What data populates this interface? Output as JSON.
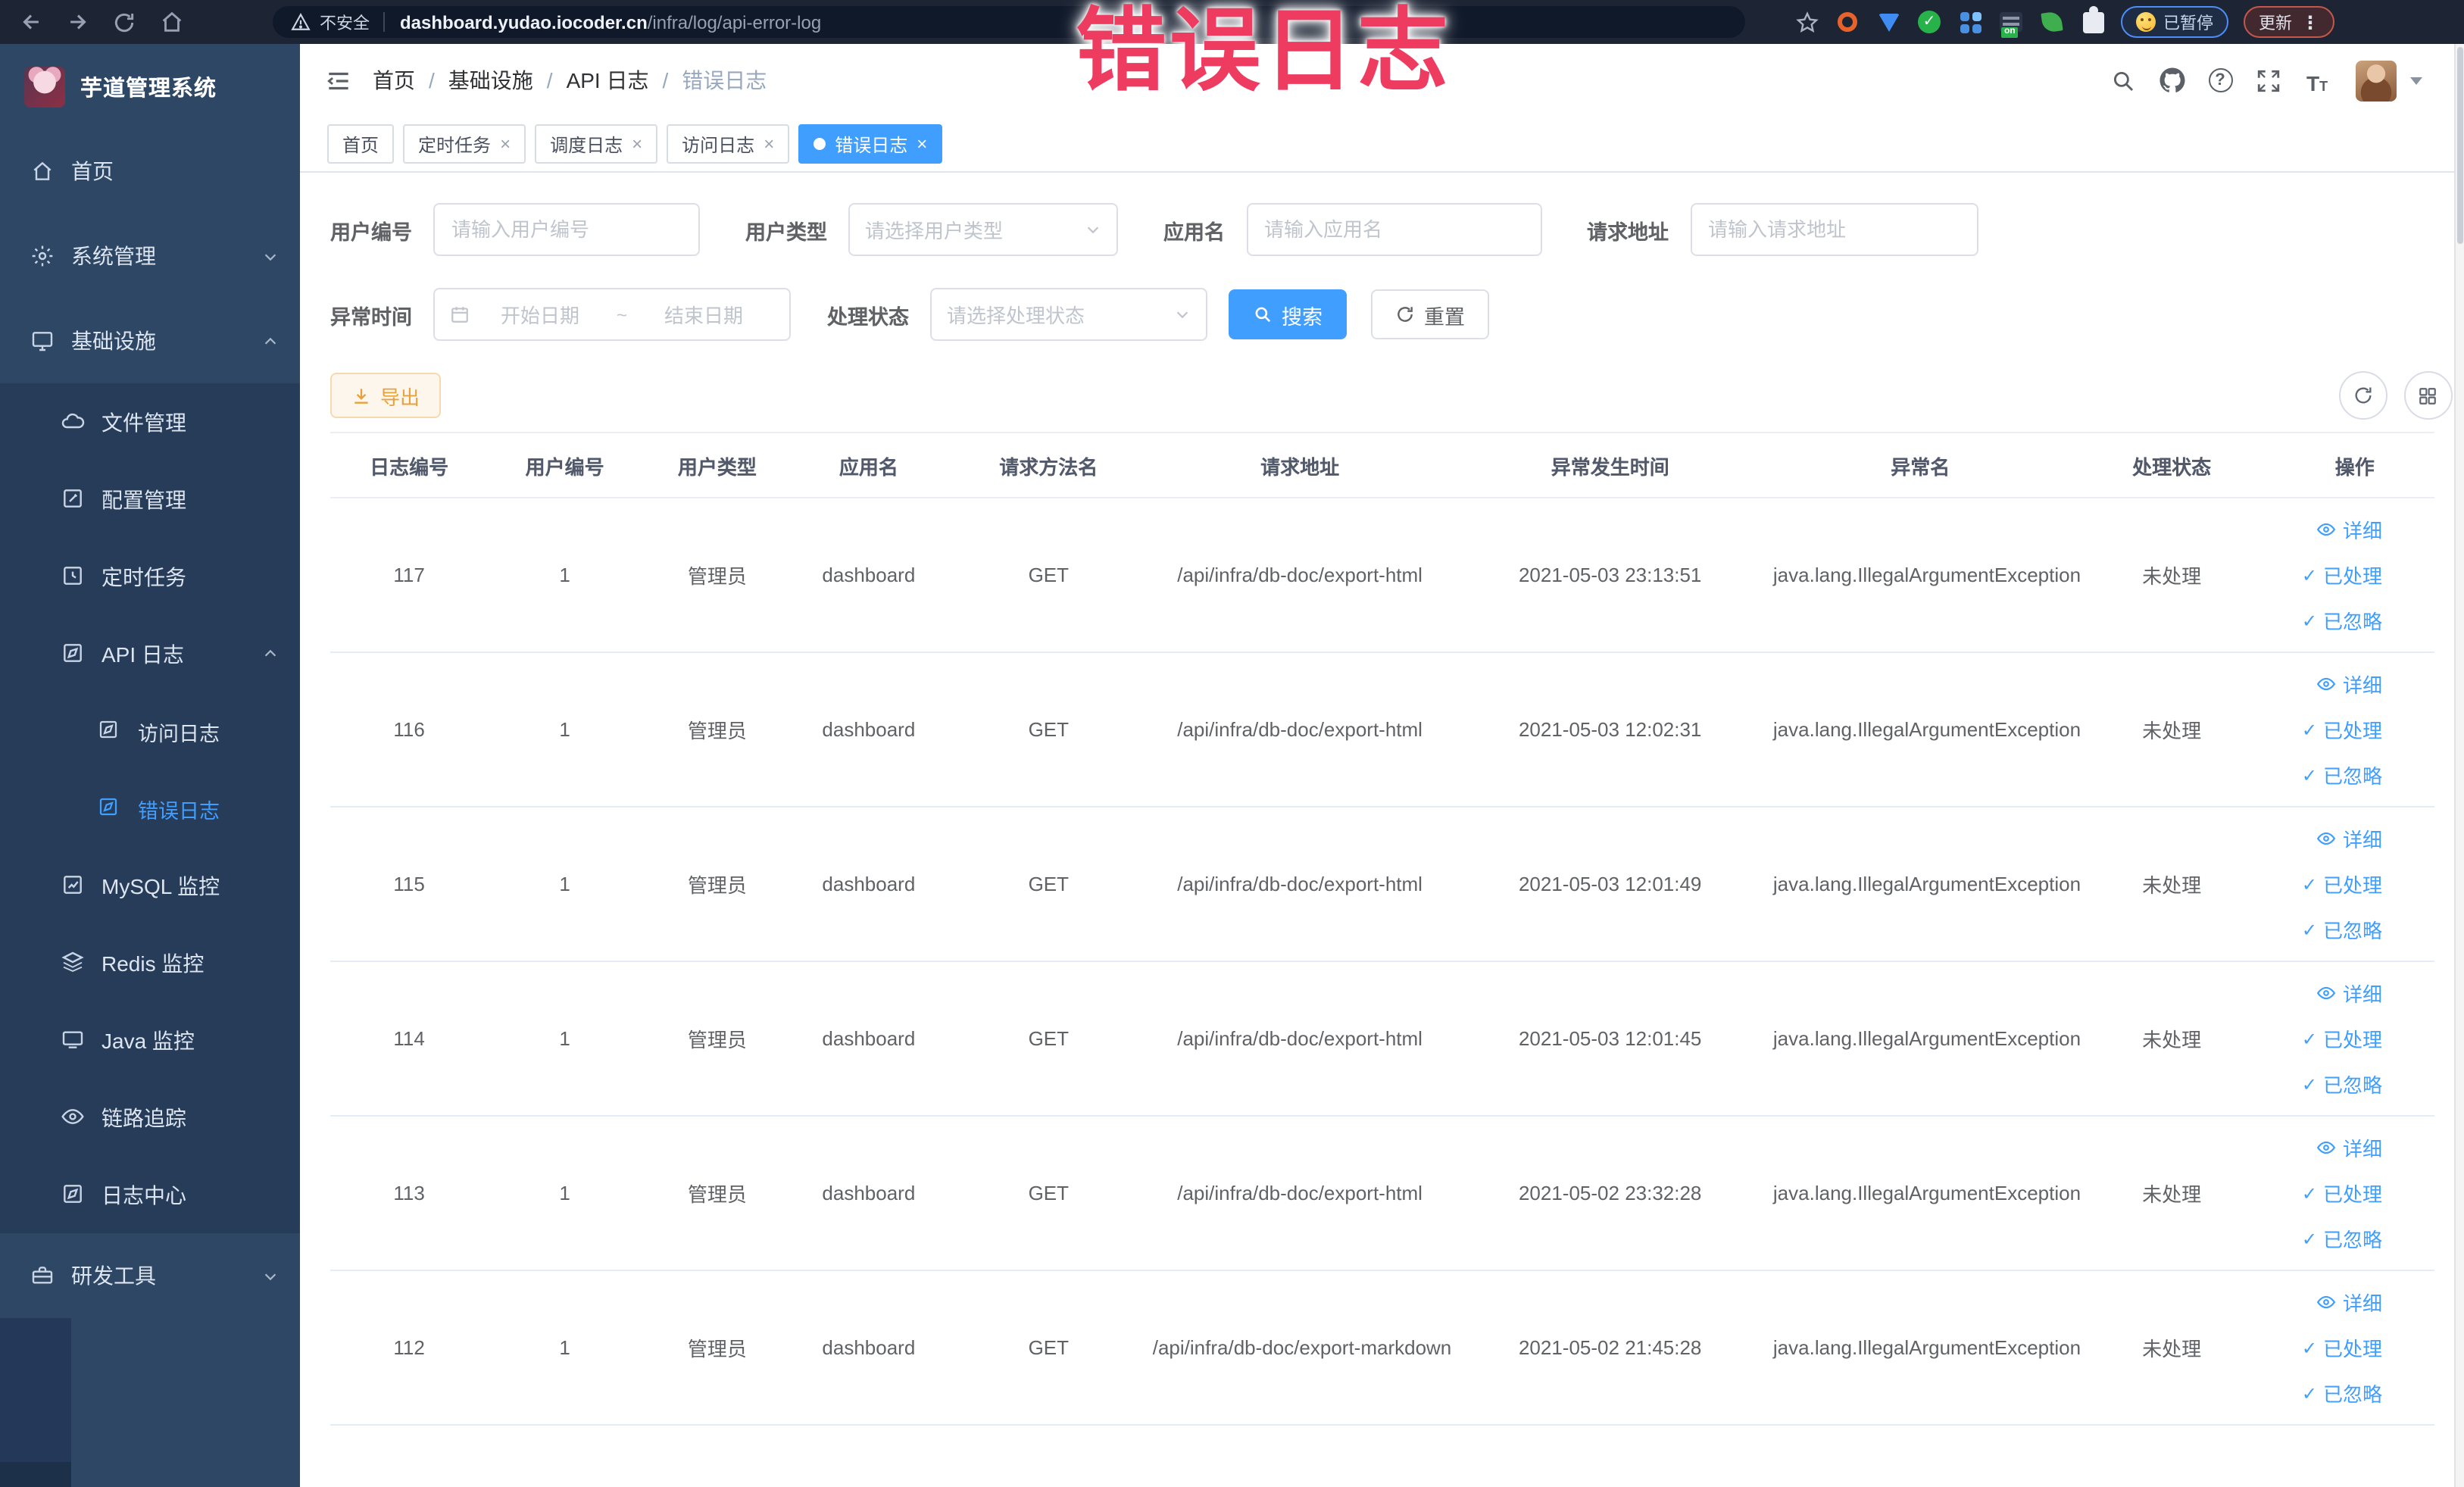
{
  "colors": {
    "accent": "#409eff",
    "watermark": "#ee3b60",
    "chrome_bg": "#1d2433",
    "sidebar_bg": "#2d4765",
    "sidebar_submenu_bg": "#273c59",
    "tag_active_bg": "#409eff",
    "warning_button_bg": "#fdf6ec",
    "warning_button_text": "#e6a23c"
  },
  "watermark": {
    "text": "错误日志"
  },
  "browser": {
    "security_label": "不安全",
    "url_host": "dashboard.yudao.iocoder.cn",
    "url_path": "/infra/log/api-error-log",
    "paused_badge": "已暂停",
    "update_badge": "更新",
    "on_badge": "on"
  },
  "sidebar": {
    "title": "芋道管理系统",
    "items": [
      {
        "label": "首页"
      },
      {
        "label": "系统管理"
      },
      {
        "label": "基础设施"
      },
      {
        "label": "文件管理"
      },
      {
        "label": "配置管理"
      },
      {
        "label": "定时任务"
      },
      {
        "label": "API 日志"
      },
      {
        "label": "访问日志"
      },
      {
        "label": "错误日志"
      },
      {
        "label": "MySQL 监控"
      },
      {
        "label": "Redis 监控"
      },
      {
        "label": "Java 监控"
      },
      {
        "label": "链路追踪"
      },
      {
        "label": "日志中心"
      },
      {
        "label": "研发工具"
      }
    ]
  },
  "breadcrumb": {
    "items": [
      "首页",
      "基础设施",
      "API 日志",
      "错误日志"
    ]
  },
  "tabs": [
    {
      "label": "首页"
    },
    {
      "label": "定时任务"
    },
    {
      "label": "调度日志"
    },
    {
      "label": "访问日志"
    },
    {
      "label": "错误日志"
    }
  ],
  "filters": {
    "user_id": {
      "label": "用户编号",
      "placeholder": "请输入用户编号"
    },
    "user_type": {
      "label": "用户类型",
      "placeholder": "请选择用户类型"
    },
    "app_name": {
      "label": "应用名",
      "placeholder": "请输入应用名"
    },
    "request_url": {
      "label": "请求地址",
      "placeholder": "请输入请求地址"
    },
    "exception_time": {
      "label": "异常时间",
      "start_placeholder": "开始日期",
      "separator": "~",
      "end_placeholder": "结束日期"
    },
    "process_status": {
      "label": "处理状态",
      "placeholder": "请选择处理状态"
    },
    "search_label": "搜索",
    "reset_label": "重置"
  },
  "toolbar": {
    "export_label": "导出"
  },
  "table": {
    "columns": [
      "日志编号",
      "用户编号",
      "用户类型",
      "应用名",
      "请求方法名",
      "请求地址",
      "异常发生时间",
      "异常名",
      "处理状态",
      "操作"
    ],
    "actions": {
      "detail": "详细",
      "processed": "已处理",
      "ignored": "已忽略"
    },
    "rows": [
      {
        "id": "117",
        "user_id": "1",
        "user_type": "管理员",
        "app": "dashboard",
        "method": "GET",
        "url": "/api/infra/db-doc/export-html",
        "time": "2021-05-03 23:13:51",
        "exception": "java.lang.IllegalArgumentException",
        "status": "未处理"
      },
      {
        "id": "116",
        "user_id": "1",
        "user_type": "管理员",
        "app": "dashboard",
        "method": "GET",
        "url": "/api/infra/db-doc/export-html",
        "time": "2021-05-03 12:02:31",
        "exception": "java.lang.IllegalArgumentException",
        "status": "未处理"
      },
      {
        "id": "115",
        "user_id": "1",
        "user_type": "管理员",
        "app": "dashboard",
        "method": "GET",
        "url": "/api/infra/db-doc/export-html",
        "time": "2021-05-03 12:01:49",
        "exception": "java.lang.IllegalArgumentException",
        "status": "未处理"
      },
      {
        "id": "114",
        "user_id": "1",
        "user_type": "管理员",
        "app": "dashboard",
        "method": "GET",
        "url": "/api/infra/db-doc/export-html",
        "time": "2021-05-03 12:01:45",
        "exception": "java.lang.IllegalArgumentException",
        "status": "未处理"
      },
      {
        "id": "113",
        "user_id": "1",
        "user_type": "管理员",
        "app": "dashboard",
        "method": "GET",
        "url": "/api/infra/db-doc/export-html",
        "time": "2021-05-02 23:32:28",
        "exception": "java.lang.IllegalArgumentException",
        "status": "未处理"
      },
      {
        "id": "112",
        "user_id": "1",
        "user_type": "管理员",
        "app": "dashboard",
        "method": "GET",
        "url": "/api/infra/db-doc/export-markdown",
        "time": "2021-05-02 21:45:28",
        "exception": "java.lang.IllegalArgumentException",
        "status": "未处理"
      }
    ]
  }
}
